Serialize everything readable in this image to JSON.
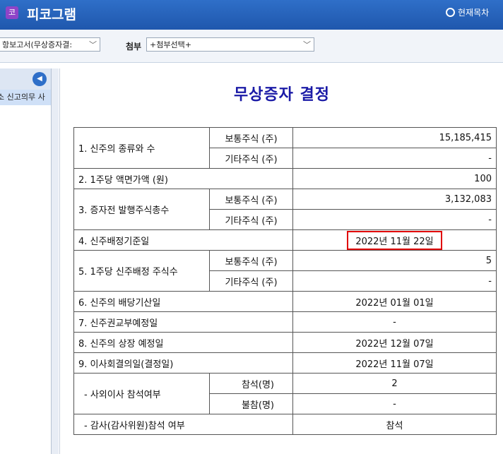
{
  "app": {
    "icon_glyph": "코",
    "title": "피코그램",
    "toc_label": "현재목차"
  },
  "toolbar": {
    "report_select": "항보고서(무상증자결:",
    "attach_label": "첨부",
    "attach_select": "+첨부선택+"
  },
  "sidebar": {
    "tree_item": "소 신고의무 사"
  },
  "document": {
    "title": "무상증자 결정",
    "rows": {
      "r1": {
        "label": "1. 신주의 종류와 수",
        "common_label": "보통주식 (주)",
        "common_value": "15,185,415",
        "other_label": "기타주식 (주)",
        "other_value": "-"
      },
      "r2": {
        "label": "2. 1주당 액면가액 (원)",
        "value": "100"
      },
      "r3": {
        "label": "3. 증자전 발행주식총수",
        "common_label": "보통주식 (주)",
        "common_value": "3,132,083",
        "other_label": "기타주식 (주)",
        "other_value": "-"
      },
      "r4": {
        "label": "4. 신주배정기준일",
        "value": "2022년 11월 22일"
      },
      "r5": {
        "label": "5. 1주당 신주배정 주식수",
        "common_label": "보통주식 (주)",
        "common_value": "5",
        "other_label": "기타주식 (주)",
        "other_value": "-"
      },
      "r6": {
        "label": "6. 신주의 배당기산일",
        "value": "2022년 01월 01일"
      },
      "r7": {
        "label": "7. 신주권교부예정일",
        "value": "-"
      },
      "r8": {
        "label": "8. 신주의 상장 예정일",
        "value": "2022년 12월 07일"
      },
      "r9": {
        "label": "9. 이사회결의일(결정일)",
        "value": "2022년 11월 07일"
      },
      "r10": {
        "label": "- 사외이사 참석여부",
        "present_label": "참석(명)",
        "present_value": "2",
        "absent_label": "불참(명)",
        "absent_value": "-"
      },
      "r11": {
        "label": "- 감사(감사위원)참석 여부",
        "value": "참석"
      }
    }
  },
  "colors": {
    "titlebar": "#2f6fc8",
    "doc_title": "#1a1aa6",
    "highlight": "#e00000"
  },
  "icons": {
    "collapse": "chevron-left-icon",
    "dropdown": "chevron-down-icon",
    "toc": "radio-icon"
  }
}
